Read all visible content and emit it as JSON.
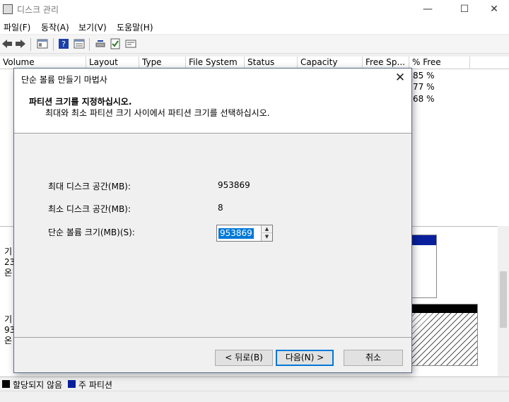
{
  "window": {
    "title": "디스크 관리"
  },
  "window_controls": {
    "minimize": "—",
    "maximize": "☐",
    "close": "✕"
  },
  "menu": [
    "파일(F)",
    "동작(A)",
    "보기(V)",
    "도움말(H)"
  ],
  "columns": [
    "Volume",
    "Layout",
    "Type",
    "File System",
    "Status",
    "Capacity",
    "Free Sp...",
    "% Free"
  ],
  "percent_free": [
    "85 %",
    "77 %",
    "68 %"
  ],
  "disk_rows": [
    {
      "line1": "기",
      "line2": "23",
      "line3": "온"
    },
    {
      "line1": "기",
      "line2": "93",
      "line3": "온"
    }
  ],
  "legend": {
    "unallocated": "할당되지 않음",
    "primary": "주 파티션",
    "unallocated_color": "#000000",
    "primary_color": "#0a1f9c"
  },
  "dialog": {
    "title": "단순 볼륨 만들기 마법사",
    "close": "✕",
    "header_title": "파티션 크기를 지정하십시오.",
    "header_subtitle": "최대와 최소 파티션 크기 사이에서 파티션 크기를 선택하십시오.",
    "max_label": "최대 디스크 공간(MB):",
    "max_value": "953869",
    "min_label": "최소 디스크 공간(MB):",
    "min_value": "8",
    "size_label": "단순 볼륨 크기(MB)(S):",
    "size_value": "953869",
    "back_button": "< 뒤로(B)",
    "next_button": "다음(N) >",
    "cancel_button": "취소"
  }
}
